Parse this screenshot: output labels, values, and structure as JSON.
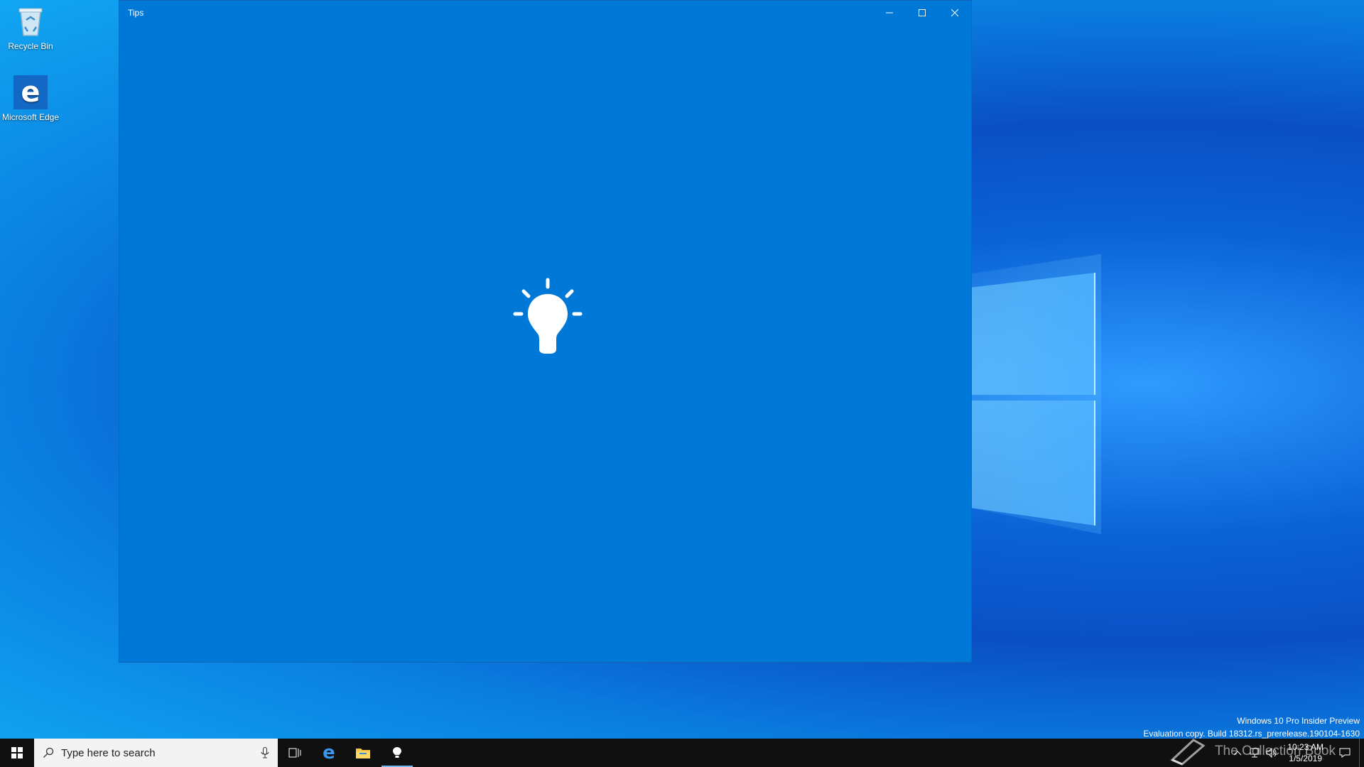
{
  "desktop": {
    "icons": [
      {
        "label": "Recycle Bin",
        "icon": "recycle-bin-icon"
      },
      {
        "label": "Microsoft Edge",
        "icon": "edge-icon"
      }
    ]
  },
  "window": {
    "title": "Tips",
    "splash_icon": "lightbulb-icon",
    "background": "#0078d7",
    "controls": [
      "minimize-icon",
      "maximize-icon",
      "close-icon"
    ]
  },
  "watermark": {
    "line1": "Windows 10 Pro Insider Preview",
    "line2": "Evaluation copy. Build 18312.rs_prerelease.190104-1630"
  },
  "taskbar": {
    "search_placeholder": "Type here to search",
    "apps": [
      "task-view-icon",
      "edge-icon",
      "file-explorer-icon"
    ],
    "tray": {
      "time": "10:23 AM",
      "date": "1/5/2019"
    }
  },
  "overlay": {
    "brand": "The Collection Book"
  }
}
